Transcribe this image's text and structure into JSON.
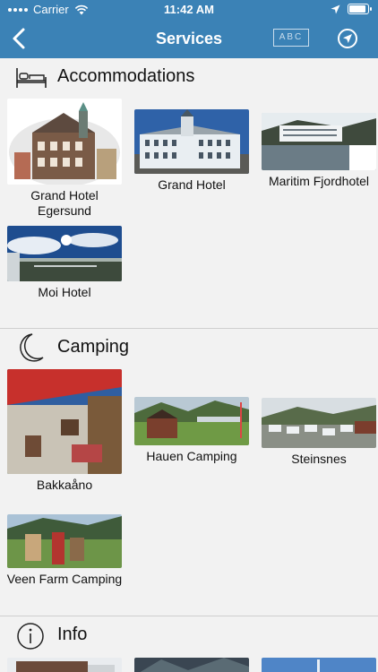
{
  "status": {
    "carrier": "Carrier",
    "time": "11:42 AM"
  },
  "nav": {
    "title": "Services",
    "abc_label": "ABC"
  },
  "sections": [
    {
      "title": "Accommodations",
      "icon": "bed-icon",
      "items": [
        {
          "name": "Grand Hotel Egersund"
        },
        {
          "name": "Grand Hotel"
        },
        {
          "name": "Maritim Fjordhotel"
        },
        {
          "name": "Moi Hotel"
        }
      ]
    },
    {
      "title": "Camping",
      "icon": "moon-icon",
      "items": [
        {
          "name": "Bakkaåno"
        },
        {
          "name": "Hauen Camping"
        },
        {
          "name": "Steinsnes"
        },
        {
          "name": "Veen Farm Camping"
        }
      ]
    },
    {
      "title": "Info",
      "icon": "info-icon",
      "items": []
    }
  ],
  "colors": {
    "nav_bar": "#3b82b6",
    "background": "#f2f2f2"
  }
}
